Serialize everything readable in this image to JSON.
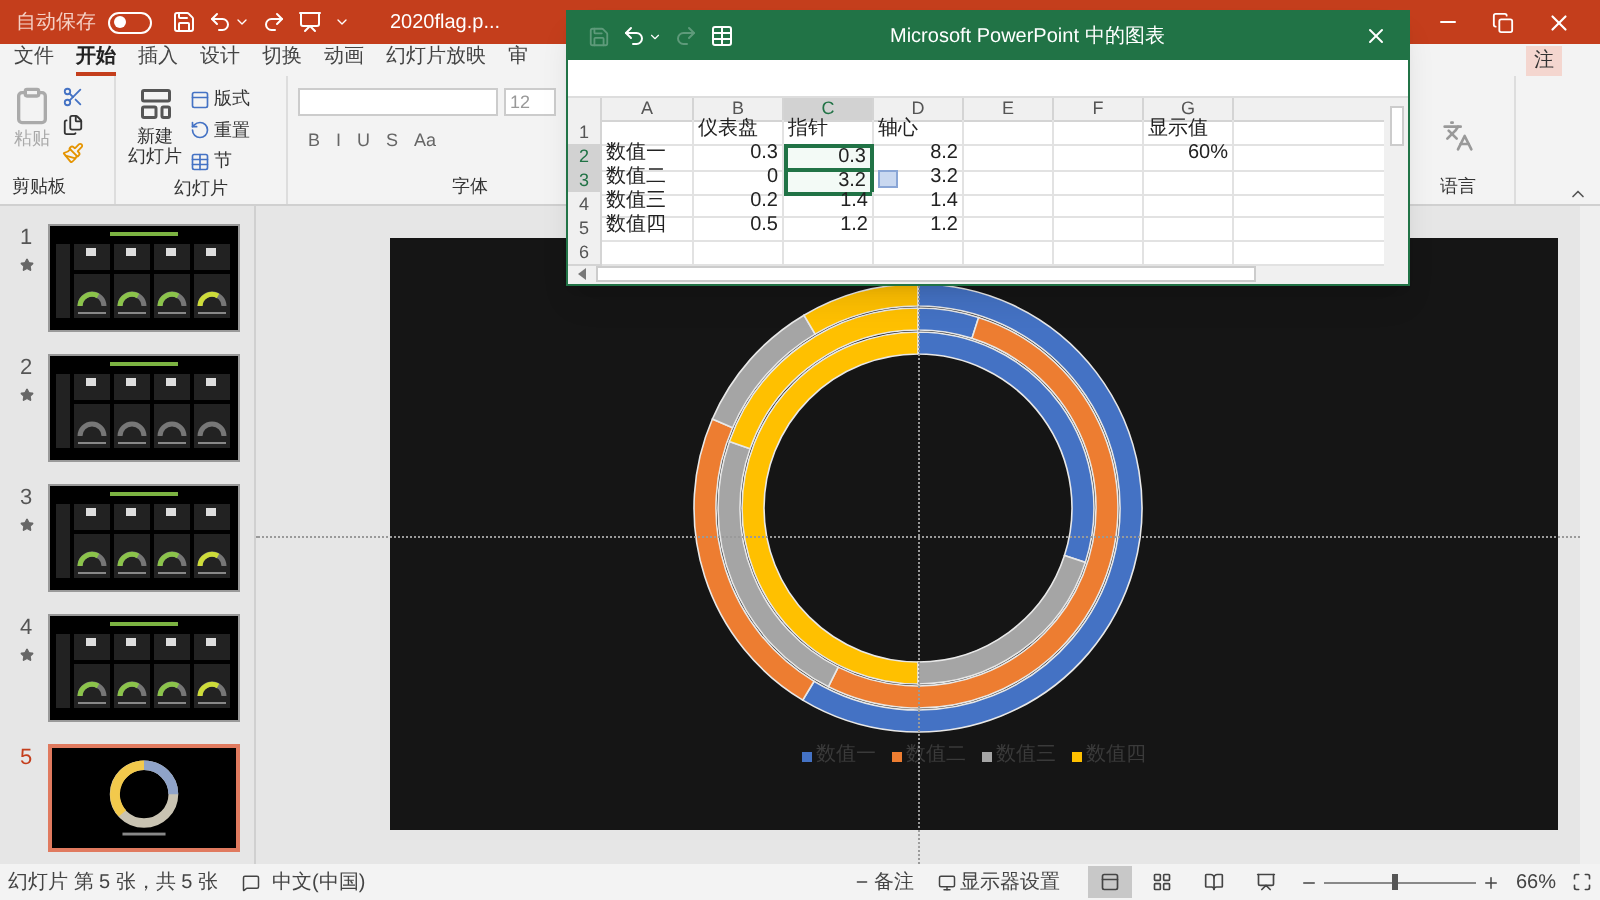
{
  "title_bar": {
    "autosave_label": "自动保存",
    "autosave_on": false,
    "file_name": "2020flag.p..."
  },
  "ribbon_tabs": [
    {
      "label": "文件",
      "selected": false
    },
    {
      "label": "开始",
      "selected": true
    },
    {
      "label": "插入",
      "selected": false
    },
    {
      "label": "设计",
      "selected": false
    },
    {
      "label": "切换",
      "selected": false
    },
    {
      "label": "动画",
      "selected": false
    },
    {
      "label": "幻灯片放映",
      "selected": false
    },
    {
      "label": "审",
      "selected": false
    }
  ],
  "comment_button": {
    "label": "注"
  },
  "ribbon": {
    "clipboard": {
      "paste": "粘贴",
      "group": "剪贴板"
    },
    "slides": {
      "new_slide": [
        "新建",
        "幻灯片"
      ],
      "layout": "版式",
      "reset": "重置",
      "section": "节",
      "group": "幻灯片"
    },
    "font": {
      "size": "12",
      "format_buttons": [
        "B",
        "I",
        "U",
        "S",
        "Aa"
      ],
      "group": "字体"
    },
    "language": {
      "group": "语言"
    }
  },
  "slides": [
    {
      "number": "1",
      "animated": true,
      "selected": false,
      "kind": "gauges"
    },
    {
      "number": "2",
      "animated": true,
      "selected": false,
      "kind": "blank-gauges"
    },
    {
      "number": "3",
      "animated": true,
      "selected": false,
      "kind": "gauges"
    },
    {
      "number": "4",
      "animated": true,
      "selected": false,
      "kind": "gauges"
    },
    {
      "number": "5",
      "animated": false,
      "selected": true,
      "kind": "donut"
    }
  ],
  "chart_window": {
    "title": "Microsoft PowerPoint 中的图表",
    "columns": [
      {
        "label": "A",
        "selected": false
      },
      {
        "label": "B",
        "selected": false
      },
      {
        "label": "C",
        "selected": true
      },
      {
        "label": "D",
        "selected": false
      },
      {
        "label": "E",
        "selected": false
      },
      {
        "label": "F",
        "selected": false
      },
      {
        "label": "G",
        "selected": false
      }
    ],
    "rows": [
      {
        "number": "1",
        "selected": false,
        "cells": [
          {
            "selected": false
          },
          {
            "text": "仪表盘",
            "kind": "text",
            "selected": false
          },
          {
            "text": "指针",
            "kind": "text",
            "selected": false
          },
          {
            "text": "轴心",
            "kind": "text",
            "selected": false
          },
          {
            "selected": false
          },
          {
            "selected": false
          },
          {
            "text": "显示值",
            "kind": "text",
            "selected": false
          }
        ]
      },
      {
        "number": "2",
        "selected": true,
        "cells": [
          {
            "text": "数值一",
            "kind": "text",
            "selected": false
          },
          {
            "text": "0.3",
            "kind": "number",
            "selected": false
          },
          {
            "text": "0.3",
            "kind": "number",
            "selected": true
          },
          {
            "text": "8.2",
            "kind": "number",
            "selected": false
          },
          {
            "selected": false
          },
          {
            "selected": false
          },
          {
            "text": "60%",
            "kind": "number",
            "selected": false
          }
        ]
      },
      {
        "number": "3",
        "selected": true,
        "cells": [
          {
            "text": "数值二",
            "kind": "text",
            "selected": false
          },
          {
            "text": "0",
            "kind": "number",
            "selected": false
          },
          {
            "text": "3.2",
            "kind": "number",
            "selected": true
          },
          {
            "text": "3.2",
            "kind": "number",
            "selected": false
          },
          {
            "selected": false
          },
          {
            "selected": false
          },
          {
            "selected": false
          }
        ]
      },
      {
        "number": "4",
        "selected": false,
        "cells": [
          {
            "text": "数值三",
            "kind": "text",
            "selected": false
          },
          {
            "text": "0.2",
            "kind": "number",
            "selected": false
          },
          {
            "text": "1.4",
            "kind": "number",
            "selected": false
          },
          {
            "text": "1.4",
            "kind": "number",
            "selected": false
          },
          {
            "selected": false
          },
          {
            "selected": false
          },
          {
            "selected": false
          }
        ]
      },
      {
        "number": "5",
        "selected": false,
        "cells": [
          {
            "text": "数值四",
            "kind": "text",
            "selected": false
          },
          {
            "text": "0.5",
            "kind": "number",
            "selected": false
          },
          {
            "text": "1.2",
            "kind": "number",
            "selected": false
          },
          {
            "text": "1.2",
            "kind": "number",
            "selected": false
          },
          {
            "selected": false
          },
          {
            "selected": false
          },
          {
            "selected": false
          }
        ]
      },
      {
        "number": "6",
        "selected": false
      }
    ]
  },
  "slide": {
    "chart_data": {
      "type": "donut",
      "categories": [
        "数值一",
        "数值二",
        "数值三",
        "数值四"
      ],
      "series": [
        {
          "colors": [
            "#4472c4",
            "#ed7d31",
            "#a5a5a5",
            "#ffc000"
          ],
          "values": [
            30,
            0,
            20,
            50
          ]
        },
        {
          "colors": [
            "#4472c4",
            "#ed7d31",
            "#a5a5a5",
            "#ffc000"
          ],
          "values": [
            4.9,
            52.5,
            23,
            19.6
          ]
        },
        {
          "colors": [
            "#4472c4",
            "#ed7d31",
            "#a5a5a5",
            "#ffc000"
          ],
          "values": [
            58.6,
            22.9,
            10,
            8.5
          ]
        }
      ]
    }
  },
  "status_bar": {
    "slide_info": "幻灯片 第 5 张，共 5 张",
    "language": "中文(中国)",
    "notes": "备注",
    "display_settings": "显示器设置",
    "views": [
      {
        "kind": "normal",
        "selected": true
      },
      {
        "kind": "sorter",
        "selected": false
      },
      {
        "kind": "reading",
        "selected": false
      },
      {
        "kind": "slideshow",
        "selected": false
      }
    ],
    "zoom": {
      "level": 0.45,
      "reading": "66%"
    }
  }
}
